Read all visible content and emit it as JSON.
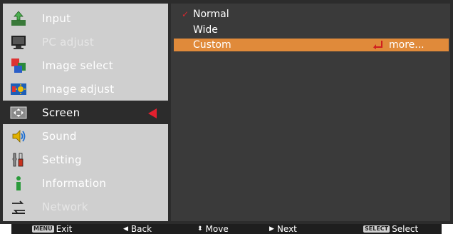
{
  "menu": {
    "items": [
      {
        "label": "Input",
        "icon": "input-icon",
        "state": "normal"
      },
      {
        "label": "PC adjust",
        "icon": "pc-adjust-icon",
        "state": "dim"
      },
      {
        "label": "Image select",
        "icon": "image-select-icon",
        "state": "normal"
      },
      {
        "label": "Image adjust",
        "icon": "image-adjust-icon",
        "state": "normal"
      },
      {
        "label": "Screen",
        "icon": "screen-icon",
        "state": "active"
      },
      {
        "label": "Sound",
        "icon": "sound-icon",
        "state": "normal"
      },
      {
        "label": "Setting",
        "icon": "setting-icon",
        "state": "normal"
      },
      {
        "label": "Information",
        "icon": "information-icon",
        "state": "normal"
      },
      {
        "label": "Network",
        "icon": "network-icon",
        "state": "dim"
      }
    ]
  },
  "submenu": {
    "options": [
      {
        "label": "Normal",
        "checked": true,
        "selected": false
      },
      {
        "label": "Wide",
        "checked": false,
        "selected": false
      },
      {
        "label": "Custom",
        "checked": false,
        "selected": true,
        "more": "more..."
      }
    ]
  },
  "footer": {
    "exit": {
      "key": "MENU",
      "label": "Exit"
    },
    "back": {
      "label": "Back"
    },
    "move": {
      "label": "Move"
    },
    "next": {
      "label": "Next"
    },
    "select": {
      "key": "SELECT",
      "label": "Select"
    }
  },
  "colors": {
    "accent": "#e08a3a",
    "indicator": "#e3202e",
    "panel": "#2c2c2c",
    "menu_bg": "#cfcfcf"
  }
}
